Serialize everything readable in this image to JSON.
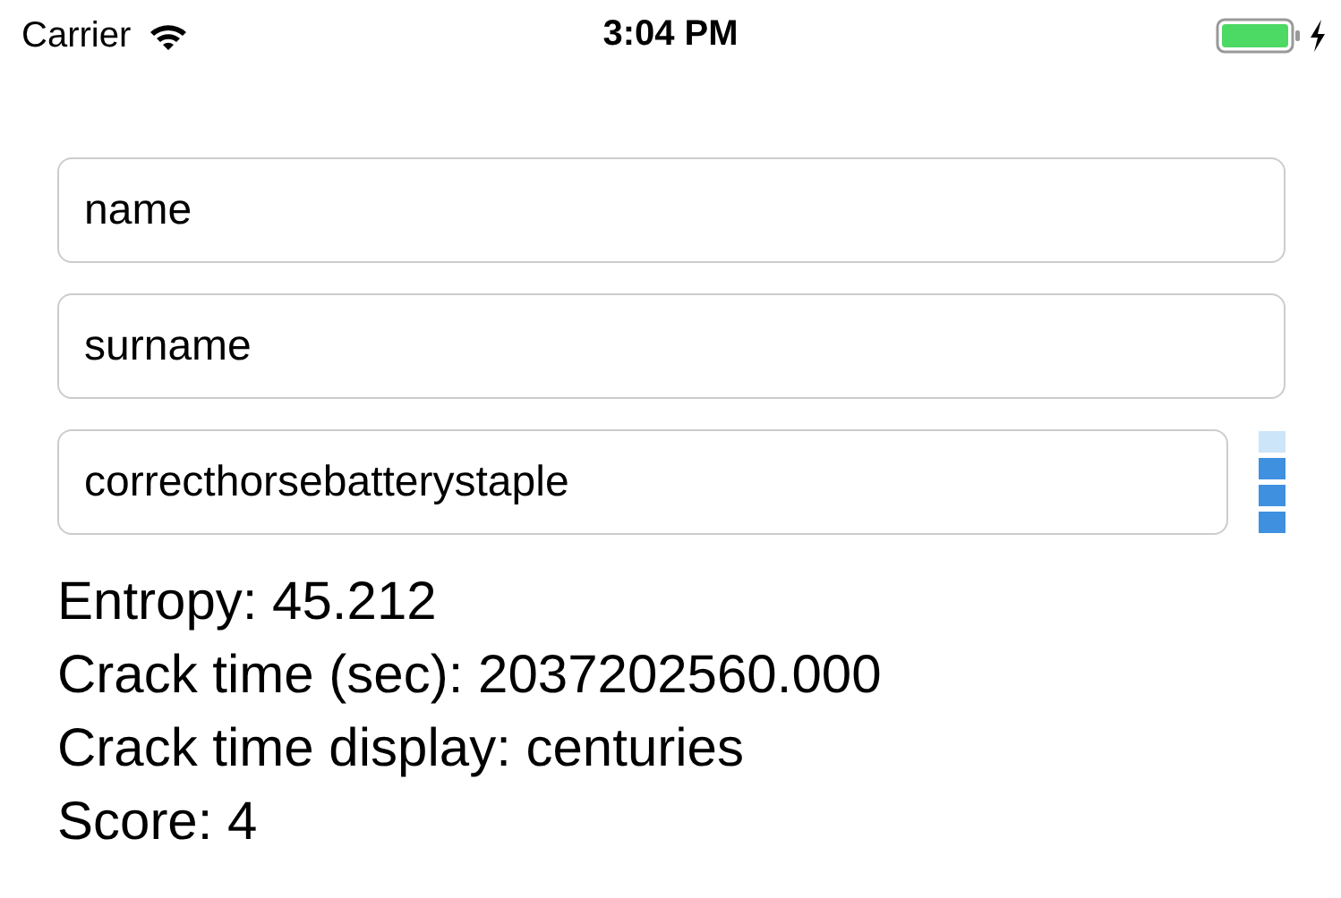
{
  "status_bar": {
    "carrier": "Carrier",
    "time": "3:04 PM"
  },
  "fields": [
    {
      "value": "name"
    },
    {
      "value": "surname"
    },
    {
      "value": "correcthorsebatterystaple"
    }
  ],
  "strength_meter": {
    "segments": [
      {
        "on": false
      },
      {
        "on": true
      },
      {
        "on": true
      },
      {
        "on": true
      }
    ]
  },
  "results": [
    "Entropy: 45.212",
    "Crack time (sec): 2037202560.000",
    "Crack time display: centuries",
    "Score: 4"
  ]
}
